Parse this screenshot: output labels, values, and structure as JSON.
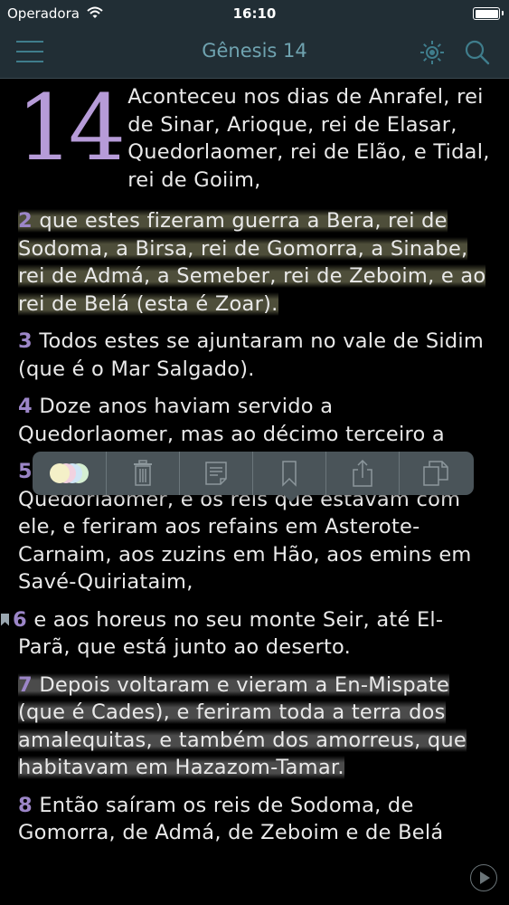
{
  "status_bar": {
    "carrier": "Operadora",
    "time": "16:10"
  },
  "navbar": {
    "title": "Gênesis 14"
  },
  "chapter": {
    "number": "14",
    "verses": [
      {
        "num": "",
        "text": "Aconteceu nos dias de Anrafel, rei de Sinar, Arioque, rei de Elasar, Quedorlaomer, rei de Elão, e Tidal, rei de Goiim,"
      },
      {
        "num": "2",
        "text": "que estes fizeram guerra a Bera, rei de Sodoma, a Birsa, rei de Gomorra, a Sinabe, rei de Admá, a Semeber, rei de Zeboim, e ao rei de Belá (esta é Zoar).",
        "highlight": "olive"
      },
      {
        "num": "3",
        "text": "Todos estes se ajuntaram no vale de Sidim (que é o Mar Salgado)."
      },
      {
        "num": "4",
        "text": "Doze anos haviam servido a Quedorlaomer, mas ao décimo terceiro a"
      },
      {
        "num": "5",
        "text": "Por isso, ao décimo quarto ano veio Quedorlaomer, e os reis que estavam com ele, e feriram aos refains em Asterote-Carnaim, aos zuzins em Hão, aos emins em Savé-Quiriataim,"
      },
      {
        "num": "6",
        "text": "e aos horeus no seu monte Seir, até El-Parã, que está junto ao deserto.",
        "bookmarked": true
      },
      {
        "num": "7",
        "text": "Depois voltaram e vieram a En-Mispate (que é Cades), e feriram toda a terra dos amalequitas, e também dos amorreus, que habitavam em Hazazom-Tamar.",
        "highlight": "gray"
      },
      {
        "num": "8",
        "text": "Então saíram os reis de Sodoma, de Gomorra, de Admá, de Zeboim e de Belá"
      }
    ]
  },
  "toolbar": {
    "actions": [
      "highlight-colors",
      "delete",
      "note",
      "bookmark",
      "share",
      "copy"
    ],
    "highlight_colors": [
      "#f4f0c8",
      "#f2d2e0",
      "#cfe6f6",
      "#d5efd2"
    ]
  },
  "colors": {
    "bar_background": "#212e35",
    "accent": "#6fa3b0",
    "verse_number": "#9c86c8",
    "dropcap": "#b69bd8"
  }
}
